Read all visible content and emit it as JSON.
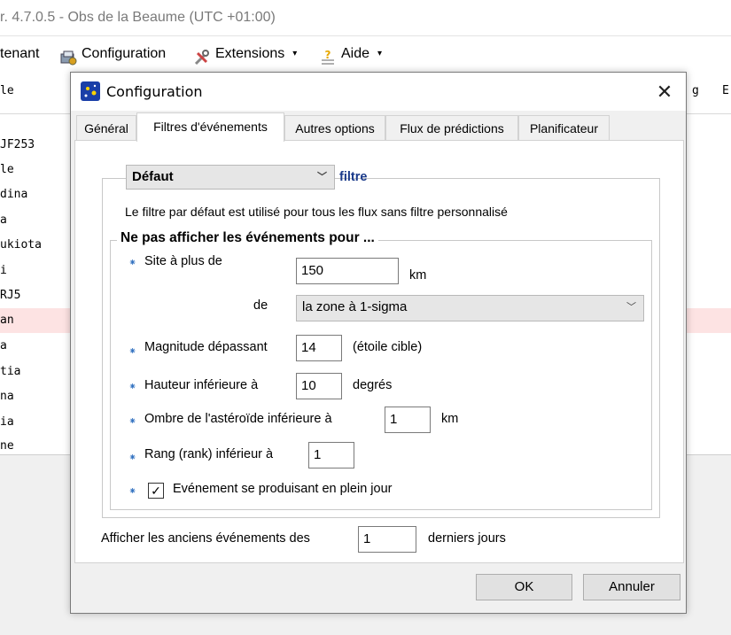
{
  "app": {
    "title": "r. 4.7.0.5 - Obs de la Beaume (UTC +01:00)",
    "menu": [
      {
        "label": "tenant"
      },
      {
        "label": "Configuration",
        "icon": "configuration-icon"
      },
      {
        "label": "Extensions",
        "icon": "tools-icon",
        "caret": "▾"
      },
      {
        "label": "Aide",
        "icon": "help-icon",
        "caret": "▾"
      }
    ],
    "table": {
      "header_left": "le",
      "header_right_1": "g",
      "header_right_2": "E",
      "rows": [
        "JF253",
        "le",
        "dina",
        "a",
        "ukiota",
        "i",
        "RJ5",
        "an",
        "a",
        "tia",
        "na",
        "ia",
        "ne"
      ]
    }
  },
  "dialog": {
    "title": "Configuration",
    "close_label": "✕",
    "tabs": [
      "Général",
      "Filtres d'événements",
      "Autres options",
      "Flux de prédictions",
      "Planificateur"
    ],
    "active_tab": 1,
    "filter": {
      "selected": "Défaut",
      "group_label": "filtre",
      "description": "Le filtre par défaut est utilisé pour tous les flux sans filtre personnalisé"
    },
    "hide_group": {
      "title": "Ne pas afficher les événements pour ...",
      "site_label": "Site à plus de",
      "site_value": "150",
      "site_unit": "km",
      "de_label": "de",
      "zone_selected": "la zone à 1-sigma",
      "magnitude_label": "Magnitude dépassant",
      "magnitude_value": "14",
      "magnitude_suffix": "(étoile cible)",
      "height_label": "Hauteur inférieure à",
      "height_value": "10",
      "height_unit": "degrés",
      "shadow_label": "Ombre de l'astéroïde inférieure à",
      "shadow_value": "1",
      "shadow_unit": "km",
      "rank_label": "Rang (rank) inférieur à",
      "rank_value": "1",
      "daylight_label": "Evénement se produisant en plein jour",
      "daylight_checked": "✓"
    },
    "old_events": {
      "label": "Afficher les anciens événements des",
      "value": "1",
      "suffix": "derniers jours"
    },
    "buttons": {
      "ok": "OK",
      "cancel": "Annuler"
    },
    "bullet_glyph": "⁕"
  }
}
